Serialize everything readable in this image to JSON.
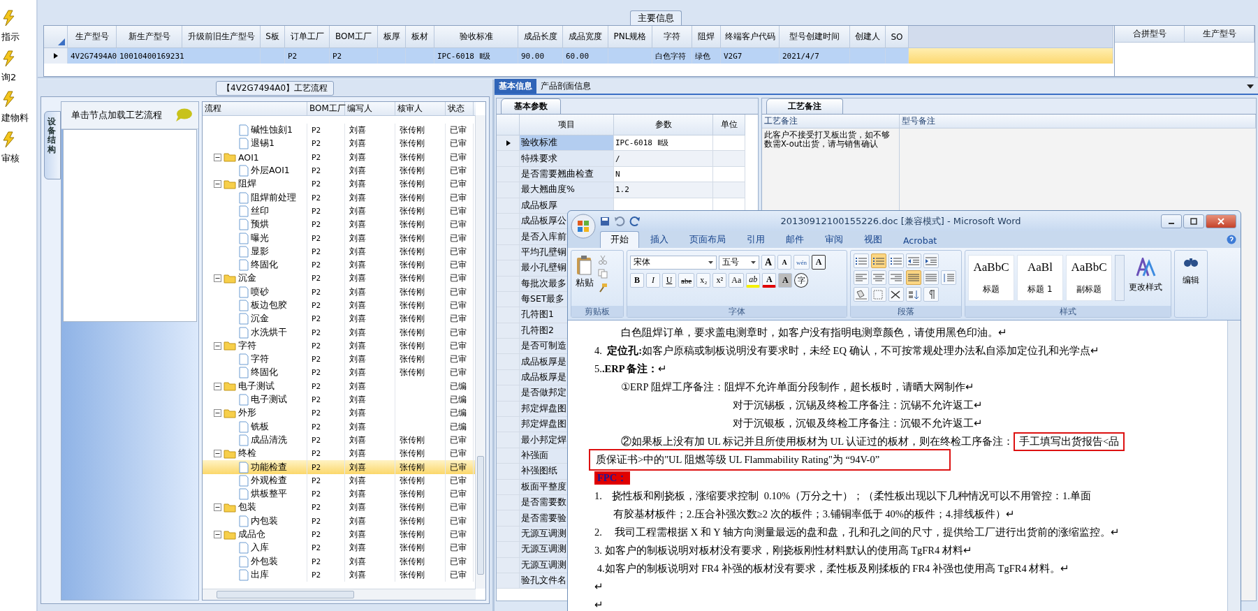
{
  "sidebar": {
    "items": [
      {
        "label": "指示",
        "selected": false
      },
      {
        "label": "询2",
        "selected": false
      },
      {
        "label": "建物料",
        "selected": false
      },
      {
        "label": "审核",
        "selected": false
      }
    ]
  },
  "main_info": {
    "title": "主要信息",
    "row_selected": true,
    "columns": [
      {
        "label": "生产型号",
        "value": "4V2G7494A0"
      },
      {
        "label": "新生产型号",
        "value": "10010400169231"
      },
      {
        "label": "升级前旧生产型号"
      },
      {
        "label": "S板"
      },
      {
        "label": "订单工厂",
        "value": "P2"
      },
      {
        "label": "BOM工厂",
        "value": "P2"
      },
      {
        "label": "板厚"
      },
      {
        "label": "板材"
      },
      {
        "label": "验收标准",
        "value": "IPC-6018 Ⅱ级"
      },
      {
        "label": "成品长度",
        "value": "90.00"
      },
      {
        "label": "成品宽度",
        "value": "60.00"
      },
      {
        "label": "PNL规格"
      },
      {
        "label": "字符",
        "value": "白色字符"
      },
      {
        "label": "阻焊",
        "value": "绿色"
      },
      {
        "label": "终端客户代码",
        "value": "V2G7"
      },
      {
        "label": "型号创建时间",
        "value": "2021/4/7"
      },
      {
        "label": "创建人"
      },
      {
        "label": "SO"
      }
    ],
    "merge_columns": [
      "合拼型号",
      "生产型号"
    ]
  },
  "process_panel": {
    "title": "【4V2G7494A0】工艺流程",
    "side_tab": "设备结构",
    "hint": "单击节点加载工艺流程",
    "tree": {
      "columns": [
        "流程",
        "BOM工厂",
        "编写人",
        "核审人",
        "状态"
      ],
      "rows": [
        {
          "kind": "hidden_parent",
          "children": [
            {
              "kind": "file",
              "name": "碱性蚀刻1",
              "bom": "P2",
              "writer": "刘喜",
              "reviewer": "张传刚",
              "status": "已审",
              "selected": false
            },
            {
              "kind": "file",
              "name": "退锡1",
              "bom": "P2",
              "writer": "刘喜",
              "reviewer": "张传刚",
              "status": "已审",
              "selected": false
            }
          ]
        },
        {
          "kind": "folder",
          "name": "AOI1",
          "bom": "P2",
          "writer": "刘喜",
          "reviewer": "张传刚",
          "status": "已审",
          "selected": false,
          "expanded": true,
          "children": [
            {
              "kind": "file",
              "name": "外层AOI1",
              "bom": "P2",
              "writer": "刘喜",
              "reviewer": "张传刚",
              "status": "已审",
              "selected": false
            }
          ]
        },
        {
          "kind": "folder",
          "name": "阻焊",
          "bom": "P2",
          "writer": "刘喜",
          "reviewer": "张传刚",
          "status": "已审",
          "selected": false,
          "expanded": true,
          "children": [
            {
              "kind": "file",
              "name": "阻焊前处理",
              "bom": "P2",
              "writer": "刘喜",
              "reviewer": "张传刚",
              "status": "已审",
              "selected": false
            },
            {
              "kind": "file",
              "name": "丝印",
              "bom": "P2",
              "writer": "刘喜",
              "reviewer": "张传刚",
              "status": "已审",
              "selected": false
            },
            {
              "kind": "file",
              "name": "预烘",
              "bom": "P2",
              "writer": "刘喜",
              "reviewer": "张传刚",
              "status": "已审",
              "selected": false
            },
            {
              "kind": "file",
              "name": "曝光",
              "bom": "P2",
              "writer": "刘喜",
              "reviewer": "张传刚",
              "status": "已审",
              "selected": false
            },
            {
              "kind": "file",
              "name": "显影",
              "bom": "P2",
              "writer": "刘喜",
              "reviewer": "张传刚",
              "status": "已审",
              "selected": false
            },
            {
              "kind": "file",
              "name": "终固化",
              "bom": "P2",
              "writer": "刘喜",
              "reviewer": "张传刚",
              "status": "已审",
              "selected": false
            }
          ]
        },
        {
          "kind": "folder",
          "name": "沉金",
          "bom": "P2",
          "writer": "刘喜",
          "reviewer": "张传刚",
          "status": "已审",
          "selected": false,
          "expanded": true,
          "children": [
            {
              "kind": "file",
              "name": "喷砂",
              "bom": "P2",
              "writer": "刘喜",
              "reviewer": "张传刚",
              "status": "已审",
              "selected": false
            },
            {
              "kind": "file",
              "name": "板边包胶",
              "bom": "P2",
              "writer": "刘喜",
              "reviewer": "张传刚",
              "status": "已审",
              "selected": false
            },
            {
              "kind": "file",
              "name": "沉金",
              "bom": "P2",
              "writer": "刘喜",
              "reviewer": "张传刚",
              "status": "已审",
              "selected": false
            },
            {
              "kind": "file",
              "name": "水洗烘干",
              "bom": "P2",
              "writer": "刘喜",
              "reviewer": "张传刚",
              "status": "已审",
              "selected": false
            }
          ]
        },
        {
          "kind": "folder",
          "name": "字符",
          "bom": "P2",
          "writer": "刘喜",
          "reviewer": "张传刚",
          "status": "已审",
          "selected": false,
          "expanded": true,
          "children": [
            {
              "kind": "file",
              "name": "字符",
              "bom": "P2",
              "writer": "刘喜",
              "reviewer": "张传刚",
              "status": "已审",
              "selected": false
            },
            {
              "kind": "file",
              "name": "终固化",
              "bom": "P2",
              "writer": "刘喜",
              "reviewer": "张传刚",
              "status": "已审",
              "selected": false
            }
          ]
        },
        {
          "kind": "folder",
          "name": "电子测试",
          "bom": "P2",
          "writer": "刘喜",
          "status": "已编",
          "selected": false,
          "expanded": true,
          "children": [
            {
              "kind": "file",
              "name": "电子测试",
              "bom": "P2",
              "writer": "刘喜",
              "status": "已编",
              "selected": false
            }
          ]
        },
        {
          "kind": "folder",
          "name": "外形",
          "bom": "P2",
          "writer": "刘喜",
          "status": "已编",
          "selected": false,
          "expanded": true,
          "children": [
            {
              "kind": "file",
              "name": "铣板",
              "bom": "P2",
              "writer": "刘喜",
              "status": "已编",
              "selected": false
            },
            {
              "kind": "file",
              "name": "成品清洗",
              "bom": "P2",
              "writer": "刘喜",
              "reviewer": "张传刚",
              "status": "已审",
              "selected": false
            }
          ]
        },
        {
          "kind": "folder",
          "name": "终检",
          "bom": "P2",
          "writer": "刘喜",
          "reviewer": "张传刚",
          "status": "已审",
          "selected": false,
          "expanded": true,
          "children": [
            {
              "kind": "file",
              "name": "功能检查",
              "bom": "P2",
              "writer": "刘喜",
              "reviewer": "张传刚",
              "status": "已审",
              "selected": true
            },
            {
              "kind": "file",
              "name": "外观检查",
              "bom": "P2",
              "writer": "刘喜",
              "reviewer": "张传刚",
              "status": "已审",
              "selected": false
            },
            {
              "kind": "file",
              "name": "烘板整平",
              "bom": "P2",
              "writer": "刘喜",
              "reviewer": "张传刚",
              "status": "已审",
              "selected": false
            }
          ]
        },
        {
          "kind": "folder",
          "name": "包装",
          "bom": "P2",
          "writer": "刘喜",
          "reviewer": "张传刚",
          "status": "已审",
          "selected": false,
          "expanded": true,
          "children": [
            {
              "kind": "file",
              "name": "内包装",
              "bom": "P2",
              "writer": "刘喜",
              "reviewer": "张传刚",
              "status": "已审",
              "selected": false
            }
          ]
        },
        {
          "kind": "folder",
          "name": "成品仓",
          "bom": "P2",
          "writer": "刘喜",
          "reviewer": "张传刚",
          "status": "已审",
          "selected": false,
          "expanded": true,
          "children": [
            {
              "kind": "file",
              "name": "入库",
              "bom": "P2",
              "writer": "刘喜",
              "reviewer": "张传刚",
              "status": "已审",
              "selected": false
            },
            {
              "kind": "file",
              "name": "外包装",
              "bom": "P2",
              "writer": "刘喜",
              "reviewer": "张传刚",
              "status": "已审",
              "selected": false
            },
            {
              "kind": "file",
              "name": "出库",
              "bom": "P2",
              "writer": "刘喜",
              "reviewer": "张传刚",
              "status": "已审",
              "selected": false
            }
          ]
        }
      ]
    }
  },
  "info_panel": {
    "tabs": [
      {
        "label": "基本信息",
        "selected": true
      },
      {
        "label": "产品剖面信息",
        "selected": false
      }
    ],
    "sub_tab": "基本参数",
    "columns": [
      "项目",
      "参数",
      "单位"
    ],
    "rows": [
      {
        "item": "验收标准",
        "value": "IPC-6018 Ⅱ级",
        "selected": true
      },
      {
        "item": "特殊要求",
        "value": "/",
        "selected": false
      },
      {
        "item": "是否需要翘曲检查",
        "value": "N",
        "selected": false
      },
      {
        "item": "最大翘曲度%",
        "value": "1.2",
        "selected": false
      },
      {
        "item": "成品板厚",
        "selected": false
      },
      {
        "item": "成品板厚公",
        "selected": false
      },
      {
        "item": "是否入库前",
        "selected": false
      },
      {
        "item": "平均孔壁铜",
        "selected": false
      },
      {
        "item": "最小孔壁铜",
        "selected": false
      },
      {
        "item": "每批次最多",
        "selected": false
      },
      {
        "item": "每SET最多",
        "selected": false
      },
      {
        "item": "孔符图1",
        "selected": false
      },
      {
        "item": "孔符图2",
        "selected": false
      },
      {
        "item": "是否可制造",
        "selected": false
      },
      {
        "item": "成品板厚是",
        "selected": false
      },
      {
        "item": "成品板厚是",
        "selected": false
      },
      {
        "item": "是否做邦定",
        "selected": false
      },
      {
        "item": "邦定焊盘图",
        "selected": false
      },
      {
        "item": "邦定焊盘图",
        "selected": false
      },
      {
        "item": "最小邦定焊",
        "selected": false
      },
      {
        "item": "补强面",
        "selected": false
      },
      {
        "item": "补强图纸",
        "selected": false
      },
      {
        "item": "板面平整度",
        "selected": false
      },
      {
        "item": "是否需要数",
        "selected": false
      },
      {
        "item": "是否需要验",
        "selected": false
      },
      {
        "item": "无源互调测",
        "selected": false
      },
      {
        "item": "无源互调测",
        "selected": false
      },
      {
        "item": "无源互调测",
        "selected": false
      },
      {
        "item": "验孔文件名",
        "selected": false
      }
    ]
  },
  "remarks_panel": {
    "tab": "工艺备注",
    "columns": [
      "工艺备注",
      "型号备注"
    ],
    "process_remark": "此客户不接受打叉板出货，如不够数需X-out出货，请与销售确认"
  },
  "word_window": {
    "title": "20130912100155226.doc [兼容模式] - Microsoft Word",
    "tabs": [
      {
        "label": "开始",
        "selected": true
      },
      {
        "label": "插入",
        "selected": false
      },
      {
        "label": "页面布局",
        "selected": false
      },
      {
        "label": "引用",
        "selected": false
      },
      {
        "label": "邮件",
        "selected": false
      },
      {
        "label": "审阅",
        "selected": false
      },
      {
        "label": "视图",
        "selected": false
      },
      {
        "label": "Acrobat",
        "selected": false
      }
    ],
    "clipboard": {
      "label": "剪贴板",
      "paste": "粘贴"
    },
    "font": {
      "label": "字体",
      "font_name": "宋体",
      "font_size": "五号",
      "top_buttons": [
        {
          "kind": "grow",
          "text": "A"
        },
        {
          "kind": "shrink",
          "text": "A"
        },
        {
          "kind": "phonetic",
          "text": "wén"
        },
        {
          "kind": "border",
          "text": "A"
        }
      ],
      "bottom_buttons": [
        {
          "kind": "bold",
          "text": "B"
        },
        {
          "kind": "italic",
          "text": "I"
        },
        {
          "kind": "underline",
          "text": "U"
        },
        {
          "kind": "strike",
          "text": "abe"
        },
        {
          "kind": "sub",
          "text": "x₂"
        },
        {
          "kind": "sup",
          "text": "x²"
        },
        {
          "kind": "case",
          "text": "Aa"
        },
        {
          "kind": "highlight",
          "text": "ab"
        },
        {
          "kind": "color",
          "text": "A"
        },
        {
          "kind": "shade",
          "text": "A"
        },
        {
          "kind": "enclose",
          "text": "字"
        }
      ]
    },
    "paragraph": {
      "label": "段落",
      "rows": [
        [
          {
            "kind": "bullets",
            "on": false
          },
          {
            "kind": "numbering",
            "on": true
          },
          {
            "kind": "multilevel",
            "on": false
          },
          {
            "kind": "outdent",
            "on": false
          },
          {
            "kind": "indent",
            "on": false
          }
        ],
        [
          {
            "kind": "left",
            "on": false
          },
          {
            "kind": "center",
            "on": false
          },
          {
            "kind": "right",
            "on": false
          },
          {
            "kind": "justify",
            "on": true
          },
          {
            "kind": "distribute",
            "on": false
          },
          {
            "kind": "spacing",
            "on": false
          }
        ],
        [
          {
            "kind": "shading",
            "on": false
          },
          {
            "kind": "borders",
            "on": false
          },
          {
            "kind": "asian",
            "on": false
          },
          {
            "kind": "sort",
            "on": false
          },
          {
            "kind": "marks",
            "on": false
          }
        ]
      ]
    },
    "styles": {
      "label": "样式",
      "items": [
        {
          "preview": "AaBbC",
          "name": "标题"
        },
        {
          "preview": "AaBl",
          "name": "标题 1"
        },
        {
          "preview": "AaBbC",
          "name": "副标题"
        }
      ],
      "change": "更改样式"
    },
    "editing": {
      "label": "编辑"
    },
    "document": {
      "lines": [
        {
          "kind": "indent",
          "text": "白色阻焊订单，要求盖电测章时，如客户没有指明电测章颜色，请使用黑色印油。↵"
        },
        {
          "kind": "para",
          "text": "4.  **定位孔:**如客户原稿或制板说明没有要求时，未经 EQ 确认，不可按常规处理办法私自添加定位孔和光学点↵"
        },
        {
          "kind": "para",
          "text": "5.**.ERP 备注：**↵"
        },
        {
          "kind": "indent",
          "text": "①ERP 阻焊工序备注：阻焊不允许单面分段制作，超长板时，请晒大网制作↵"
        },
        {
          "kind": "deep",
          "text": "对于沉锡板，沉锡及终检工序备注：沉锡不允许返工↵"
        },
        {
          "kind": "deep",
          "text": "对于沉银板，沉银及终检工序备注：沉银不允许返工↵"
        },
        {
          "kind": "indent",
          "text": "②如果板上没有加 UL 标记并且所使用板材为 UL 认证过的板材，则在终检工序备注：",
          "boxed": "手工填写出货报告<品"
        },
        {
          "kind": "para",
          "boxed": "质保证书>中的\"UL 阻燃等级 UL Flammability Rating\"为 “94V-0”"
        },
        {
          "kind": "tag",
          "text": "FPC："
        },
        {
          "kind": "para",
          "text": "1.    挠性板和刚挠板，涨缩要求控制  0.10%（万分之十）；（柔性板出现以下几种情况可以不用管控：1.单面"
        },
        {
          "kind": "hang",
          "text": "有胶基材板件；2.压合补强次数≥2 次的板件；3.铺铜率低于 40%的板件；4.排线板件）↵"
        },
        {
          "kind": "para",
          "text": "2.     我司工程需根据 X 和 Y 轴方向测量最远的盘和盘，孔和孔之间的尺寸，提供给工厂进行出货前的涨缩监控。↵"
        },
        {
          "kind": "para",
          "text": "3. 如客户的制板说明对板材没有要求，刚挠板刚性材料默认的使用高 TgFR4 材料↵"
        },
        {
          "kind": "para",
          "text": " 4.如客户的制板说明对 FR4 补强的板材没有要求，柔性板及刚揉板的 FR4 补强也使用高 TgFR4 材料。↵"
        },
        {
          "kind": "para",
          "text": "↵"
        },
        {
          "kind": "para",
          "text": "↵"
        }
      ]
    }
  }
}
